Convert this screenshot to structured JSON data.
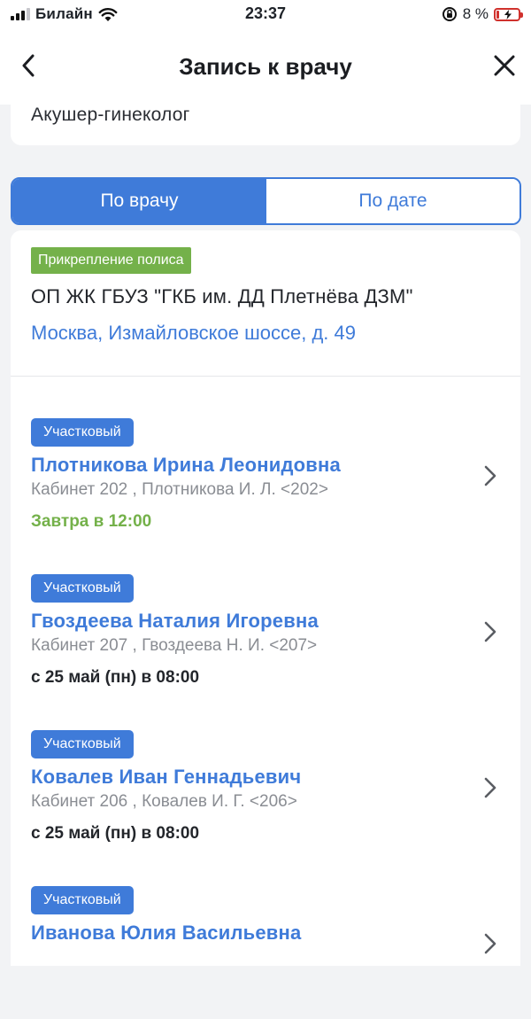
{
  "status_bar": {
    "carrier": "Билайн",
    "time": "23:37",
    "battery_percent": "8 %"
  },
  "header": {
    "title": "Запись к врачу"
  },
  "specialty": {
    "name": "Акушер-гинеколог"
  },
  "tabs": [
    {
      "label": "По врачу",
      "active": true
    },
    {
      "label": "По дате",
      "active": false
    }
  ],
  "policy": {
    "badge": "Прикрепление полиса",
    "clinic_name": "ОП ЖК ГБУЗ \"ГКБ им. ДД Плетнёва ДЗМ\"",
    "address": "Москва, Измайловское шоссе, д. 49"
  },
  "doctors": [
    {
      "badge": "Участковый",
      "name": "Плотникова Ирина Леонидовна",
      "room": "Кабинет 202 , Плотникова И. Л. <202>",
      "slot": "Завтра в 12:00"
    },
    {
      "badge": "Участковый",
      "name": "Гвоздеева Наталия Игоревна",
      "room": "Кабинет 207 , Гвоздеева Н. И. <207>",
      "slot": "с 25 май (пн)  в 08:00"
    },
    {
      "badge": "Участковый",
      "name": "Ковалев Иван Геннадьевич",
      "room": "Кабинет 206 , Ковалев И. Г. <206>",
      "slot": "с 25 май (пн)  в 08:00"
    },
    {
      "badge": "Участковый",
      "name": "Иванова Юлия Васильевна"
    }
  ],
  "colors": {
    "accent": "#3f7bd9",
    "green": "#74b14a",
    "background": "#f2f3f5"
  }
}
